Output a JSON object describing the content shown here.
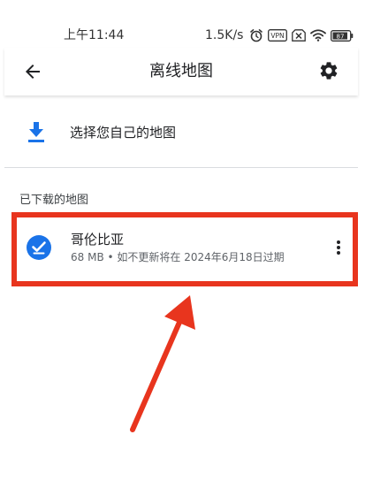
{
  "status_bar": {
    "time": "上午11:44",
    "network_speed": "1.5K/s",
    "icons": [
      "alarm-icon",
      "vpn-icon",
      "sim-off-icon",
      "wifi-icon",
      "battery-icon"
    ],
    "vpn_label": "VPN",
    "battery_level": "87"
  },
  "app_bar": {
    "title": "离线地图",
    "back_icon": "arrow-back-icon",
    "settings_icon": "gear-icon"
  },
  "select_own_map": {
    "label": "选择您自己的地图",
    "icon": "download-icon"
  },
  "downloaded_maps": {
    "header": "已下载的地图",
    "items": [
      {
        "name": "哥伦比亚",
        "details": "68 MB • 如不更新将在 2024年6月18日过期",
        "icon": "check-circle-icon",
        "menu_icon": "more-vert-icon"
      }
    ]
  },
  "colors": {
    "accent_blue": "#1a73e8",
    "annotation_red": "#e8351e",
    "text_primary": "#202124",
    "text_secondary": "#5f6368"
  }
}
